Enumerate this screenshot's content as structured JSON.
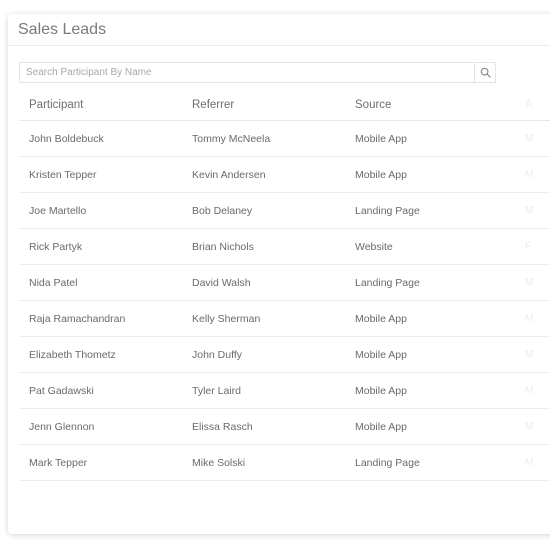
{
  "title": "Sales Leads",
  "search": {
    "placeholder": "Search Participant By Name",
    "icon": "search-icon"
  },
  "table": {
    "columns": [
      "Participant",
      "Referrer",
      "Source",
      "A"
    ],
    "rows": [
      {
        "participant": "John Boldebuck",
        "referrer": "Tommy McNeela",
        "source": "Mobile App",
        "extra": "M"
      },
      {
        "participant": "Kristen Tepper",
        "referrer": "Kevin Andersen",
        "source": "Mobile App",
        "extra": "M"
      },
      {
        "participant": "Joe Martello",
        "referrer": "Bob Delaney",
        "source": "Landing Page",
        "extra": "M"
      },
      {
        "participant": "Rick Partyk",
        "referrer": "Brian Nichols",
        "source": "Website",
        "extra": "F"
      },
      {
        "participant": "Nida Patel",
        "referrer": "David Walsh",
        "source": "Landing Page",
        "extra": "M"
      },
      {
        "participant": "Raja Ramachandran",
        "referrer": "Kelly Sherman",
        "source": "Mobile App",
        "extra": "M"
      },
      {
        "participant": "Elizabeth Thometz",
        "referrer": "John Duffy",
        "source": "Mobile App",
        "extra": "M"
      },
      {
        "participant": "Pat Gadawski",
        "referrer": "Tyler Laird",
        "source": "Mobile App",
        "extra": "M"
      },
      {
        "participant": "Jenn Glennon",
        "referrer": "Elissa Rasch",
        "source": "Mobile App",
        "extra": "M"
      },
      {
        "participant": "Mark Tepper",
        "referrer": "Mike Solski",
        "source": "Landing Page",
        "extra": "M"
      }
    ]
  }
}
